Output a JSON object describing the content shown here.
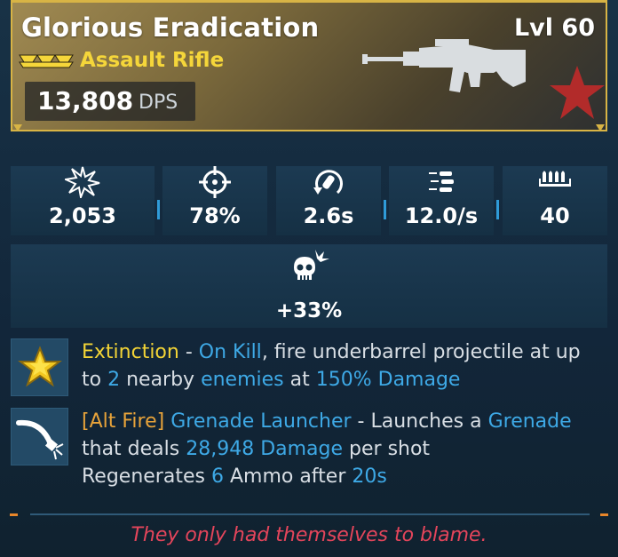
{
  "item": {
    "name": "Glorious Eradication",
    "level": "Lvl 60",
    "type": "Assault Rifle",
    "dps_value": "13,808",
    "dps_label": "DPS",
    "rarity_color": "#f5d63a"
  },
  "stats": [
    {
      "icon": "damage-burst-icon",
      "value": "2,053"
    },
    {
      "icon": "crosshair-icon",
      "value": "78%"
    },
    {
      "icon": "reload-icon",
      "value": "2.6s"
    },
    {
      "icon": "fire-rate-bullets-icon",
      "value": "12.0/s"
    },
    {
      "icon": "magazine-icon",
      "value": "40"
    }
  ],
  "crit_stat": {
    "icon": "crit-skull-icon",
    "value": "+33%"
  },
  "perks": {
    "extinction": {
      "icon": "gold-star-icon",
      "name": "Extinction",
      "sep1": " - ",
      "trigger": "On Kill",
      "text1": ", fire underbarrel projectile at up to ",
      "count": "2",
      "text2": " nearby ",
      "target": "enemies",
      "text3": " at ",
      "damage": "150% Damage"
    },
    "alt_fire": {
      "icon": "grenade-launcher-icon",
      "tag": "[Alt Fire]",
      "name": "Grenade Launcher",
      "text1": " - Launches a ",
      "projectile": "Grenade",
      "text2": " that deals ",
      "damage": "28,948 Damage",
      "text3": " per shot",
      "regen_text": "Regenerates ",
      "ammo": "6",
      "regen_mid": " Ammo after ",
      "time": "20s"
    }
  },
  "flavor": "They only had themselves to blame.",
  "colors": {
    "accent_blue": "#3ea9e6",
    "legendary_gold": "#d8b445",
    "flavor_red": "#e4455b"
  }
}
